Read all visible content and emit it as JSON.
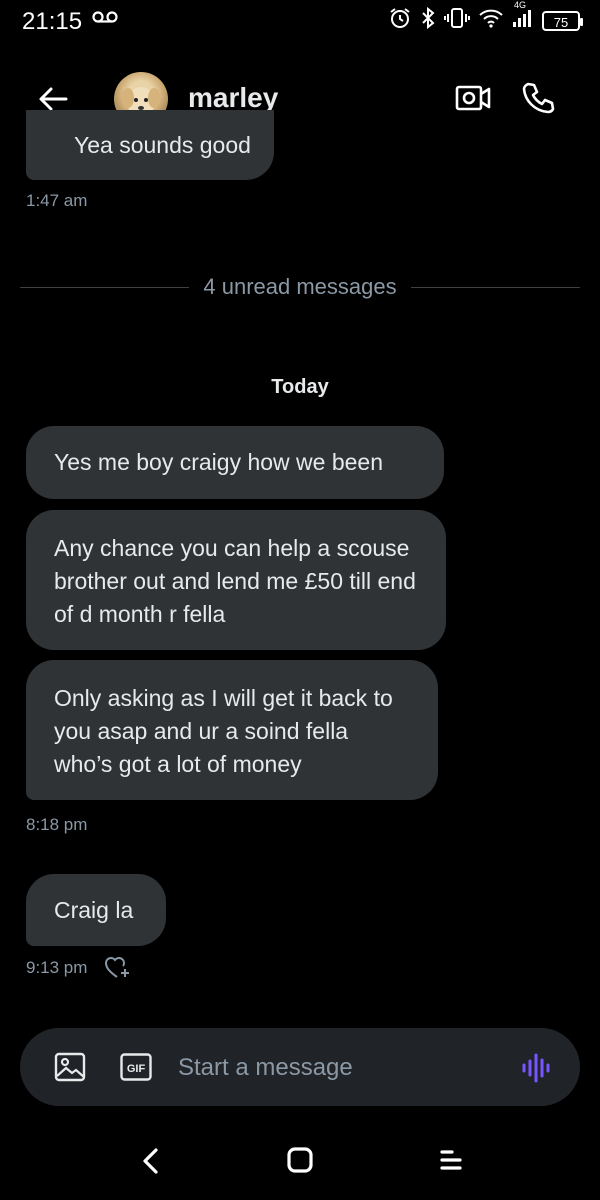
{
  "status_bar": {
    "time": "21:15",
    "network": "4G",
    "battery": "75"
  },
  "header": {
    "contact_name": "marley"
  },
  "messages": {
    "first_partial": "Yea sounds good",
    "first_time": "1:47 am",
    "unread_divider": "4 unread messages",
    "day_label": "Today",
    "items": [
      "Yes me boy craigy how we been",
      "Any chance you can help a scouse brother out and lend me £50 till end of d month r fella",
      "Only asking as I will get it back to you asap and ur a soind fella who’s got a lot of money"
    ],
    "group_time": "8:18 pm",
    "last": "Craig la",
    "last_time": "9:13 pm"
  },
  "composer": {
    "placeholder": "Start a message",
    "gif_label": "GIF"
  },
  "colors": {
    "background": "#000000",
    "bubble": "#2f3336",
    "accent": "#7856ff",
    "muted": "#8b98a5"
  }
}
